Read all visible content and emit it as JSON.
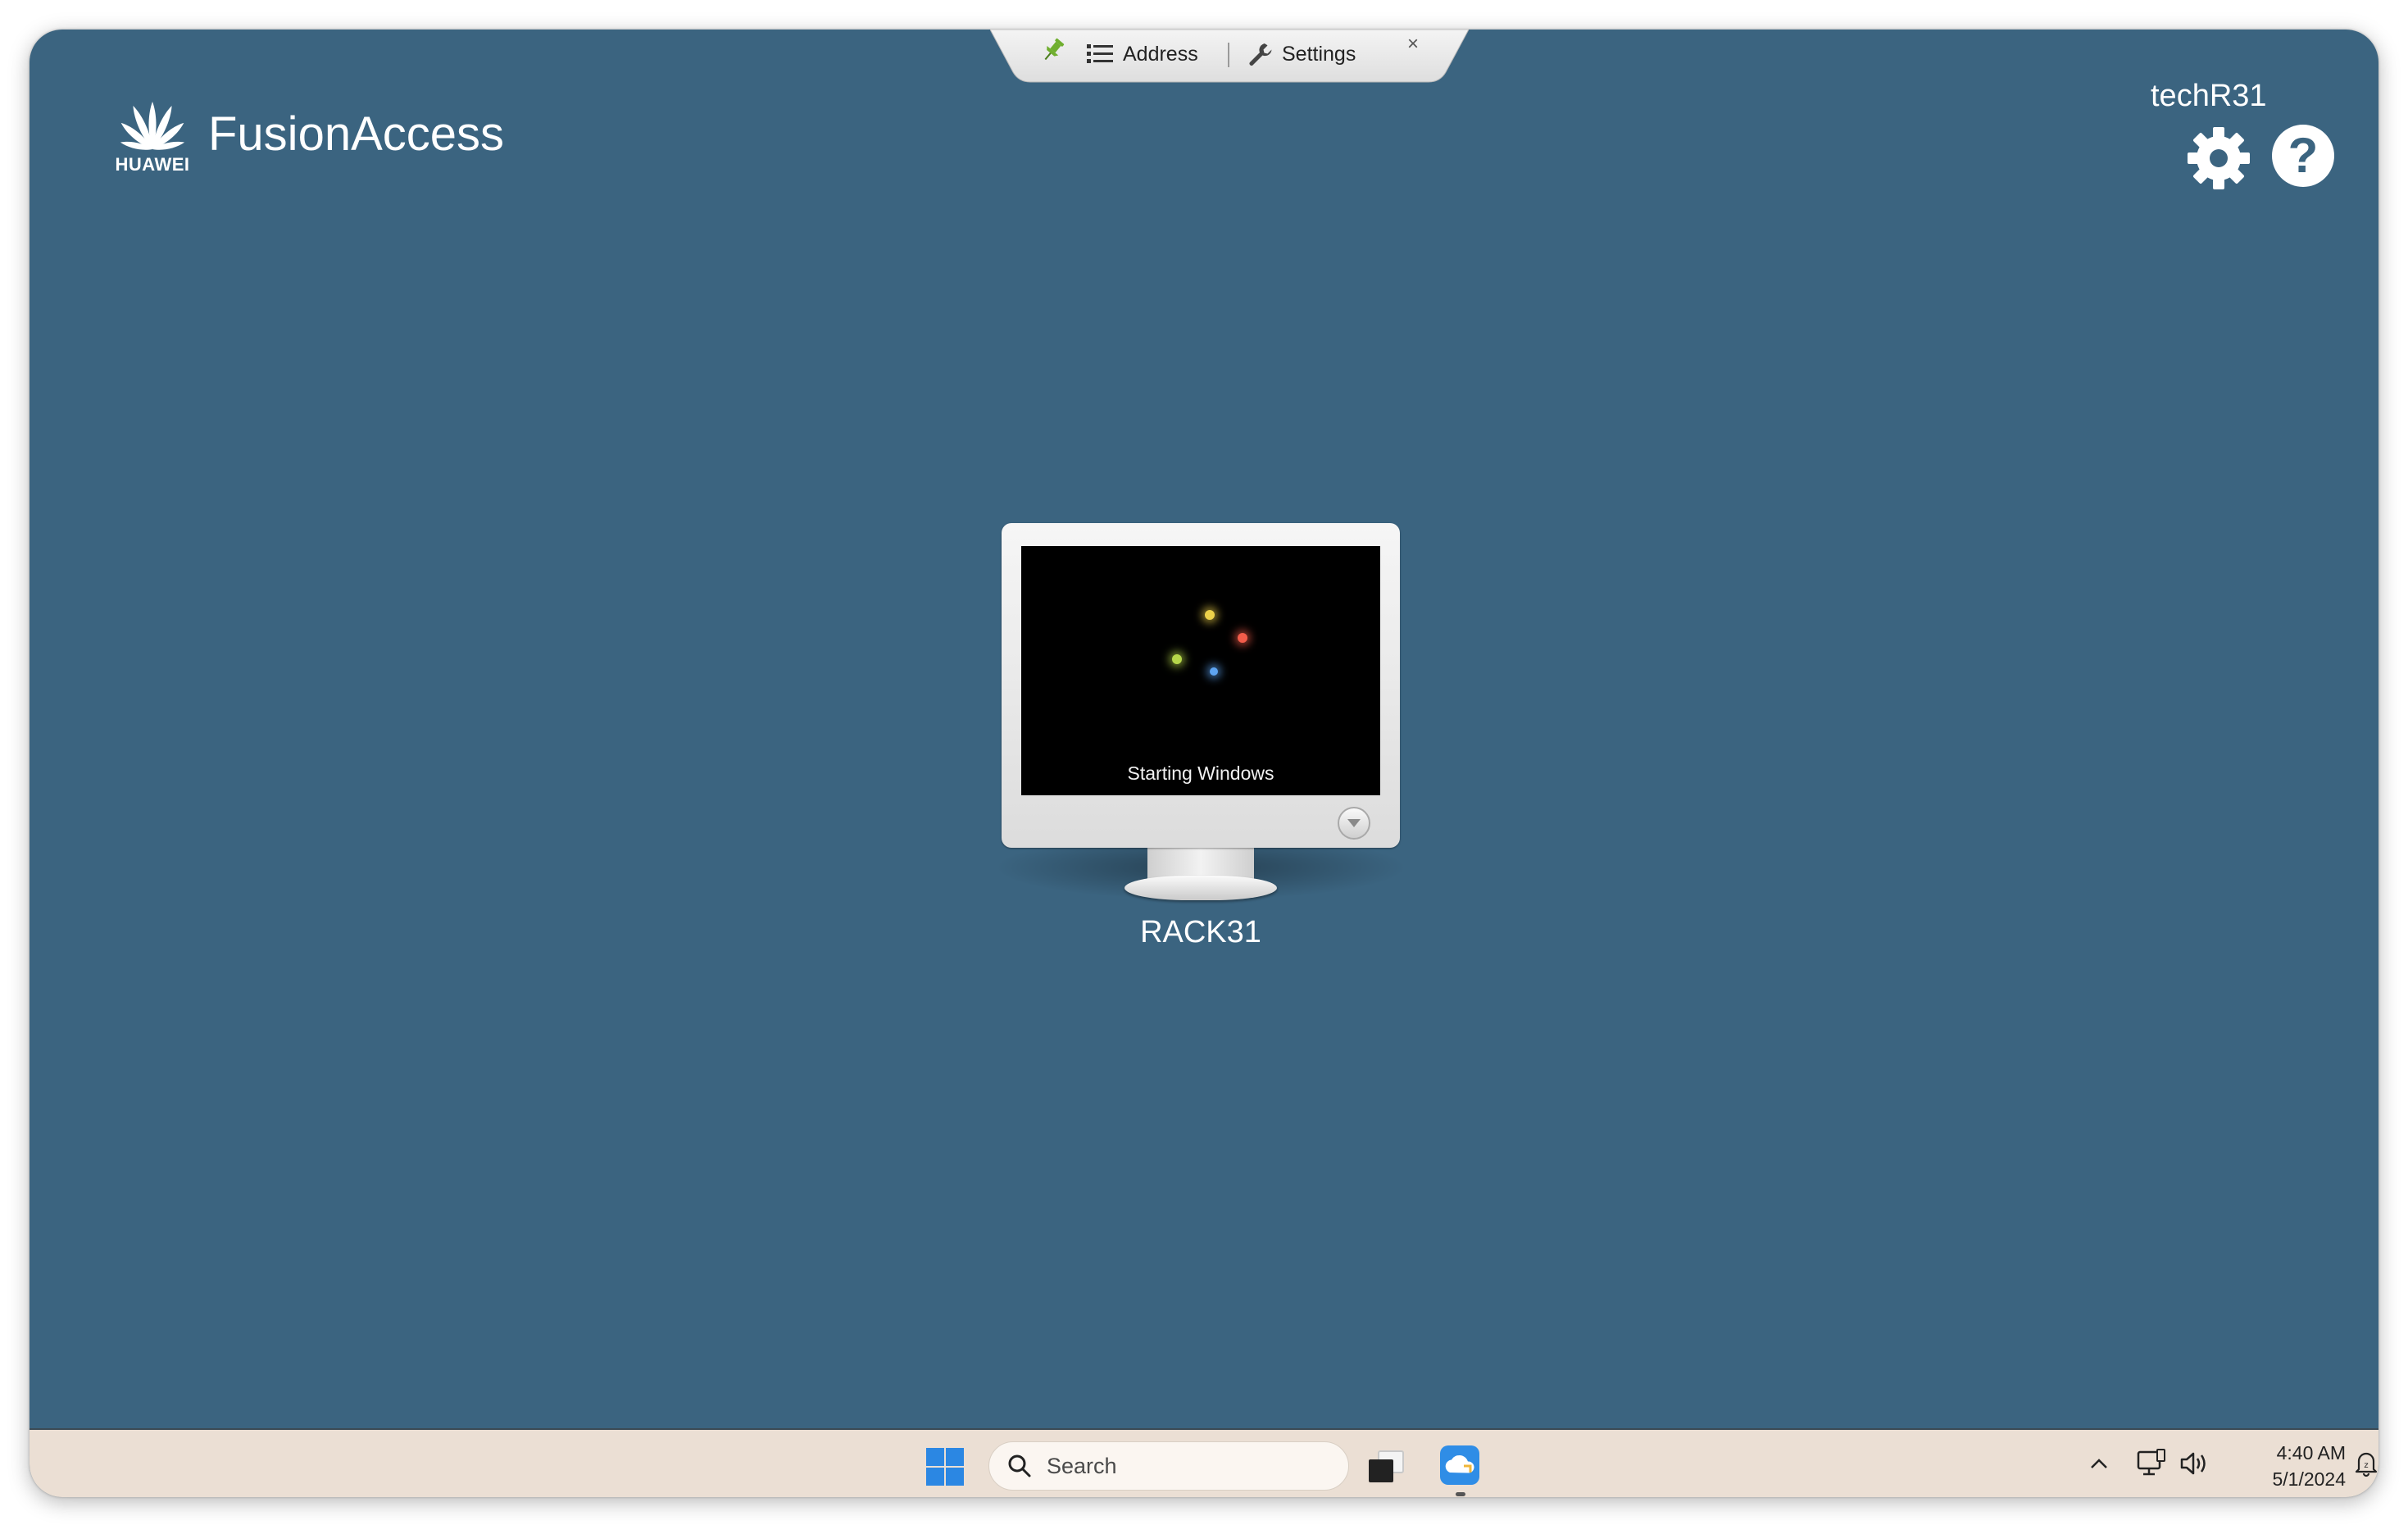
{
  "toolbar": {
    "address_label": "Address",
    "settings_label": "Settings",
    "close_glyph": "×",
    "pin_icon": "pin-icon",
    "pin_color": "#6fae2e"
  },
  "brand": {
    "company": "HUAWEI",
    "product": "FusionAccess"
  },
  "user": {
    "username": "techR31",
    "help_glyph": "?"
  },
  "desktop": {
    "name": "RACK31",
    "status": "Starting Windows"
  },
  "taskbar": {
    "search_placeholder": "Search",
    "time": "4:40 AM",
    "date": "5/1/2024"
  },
  "colors": {
    "background": "#3b6480",
    "taskbar": "#ebdfd4",
    "windows_blue": "#2b87e3"
  }
}
